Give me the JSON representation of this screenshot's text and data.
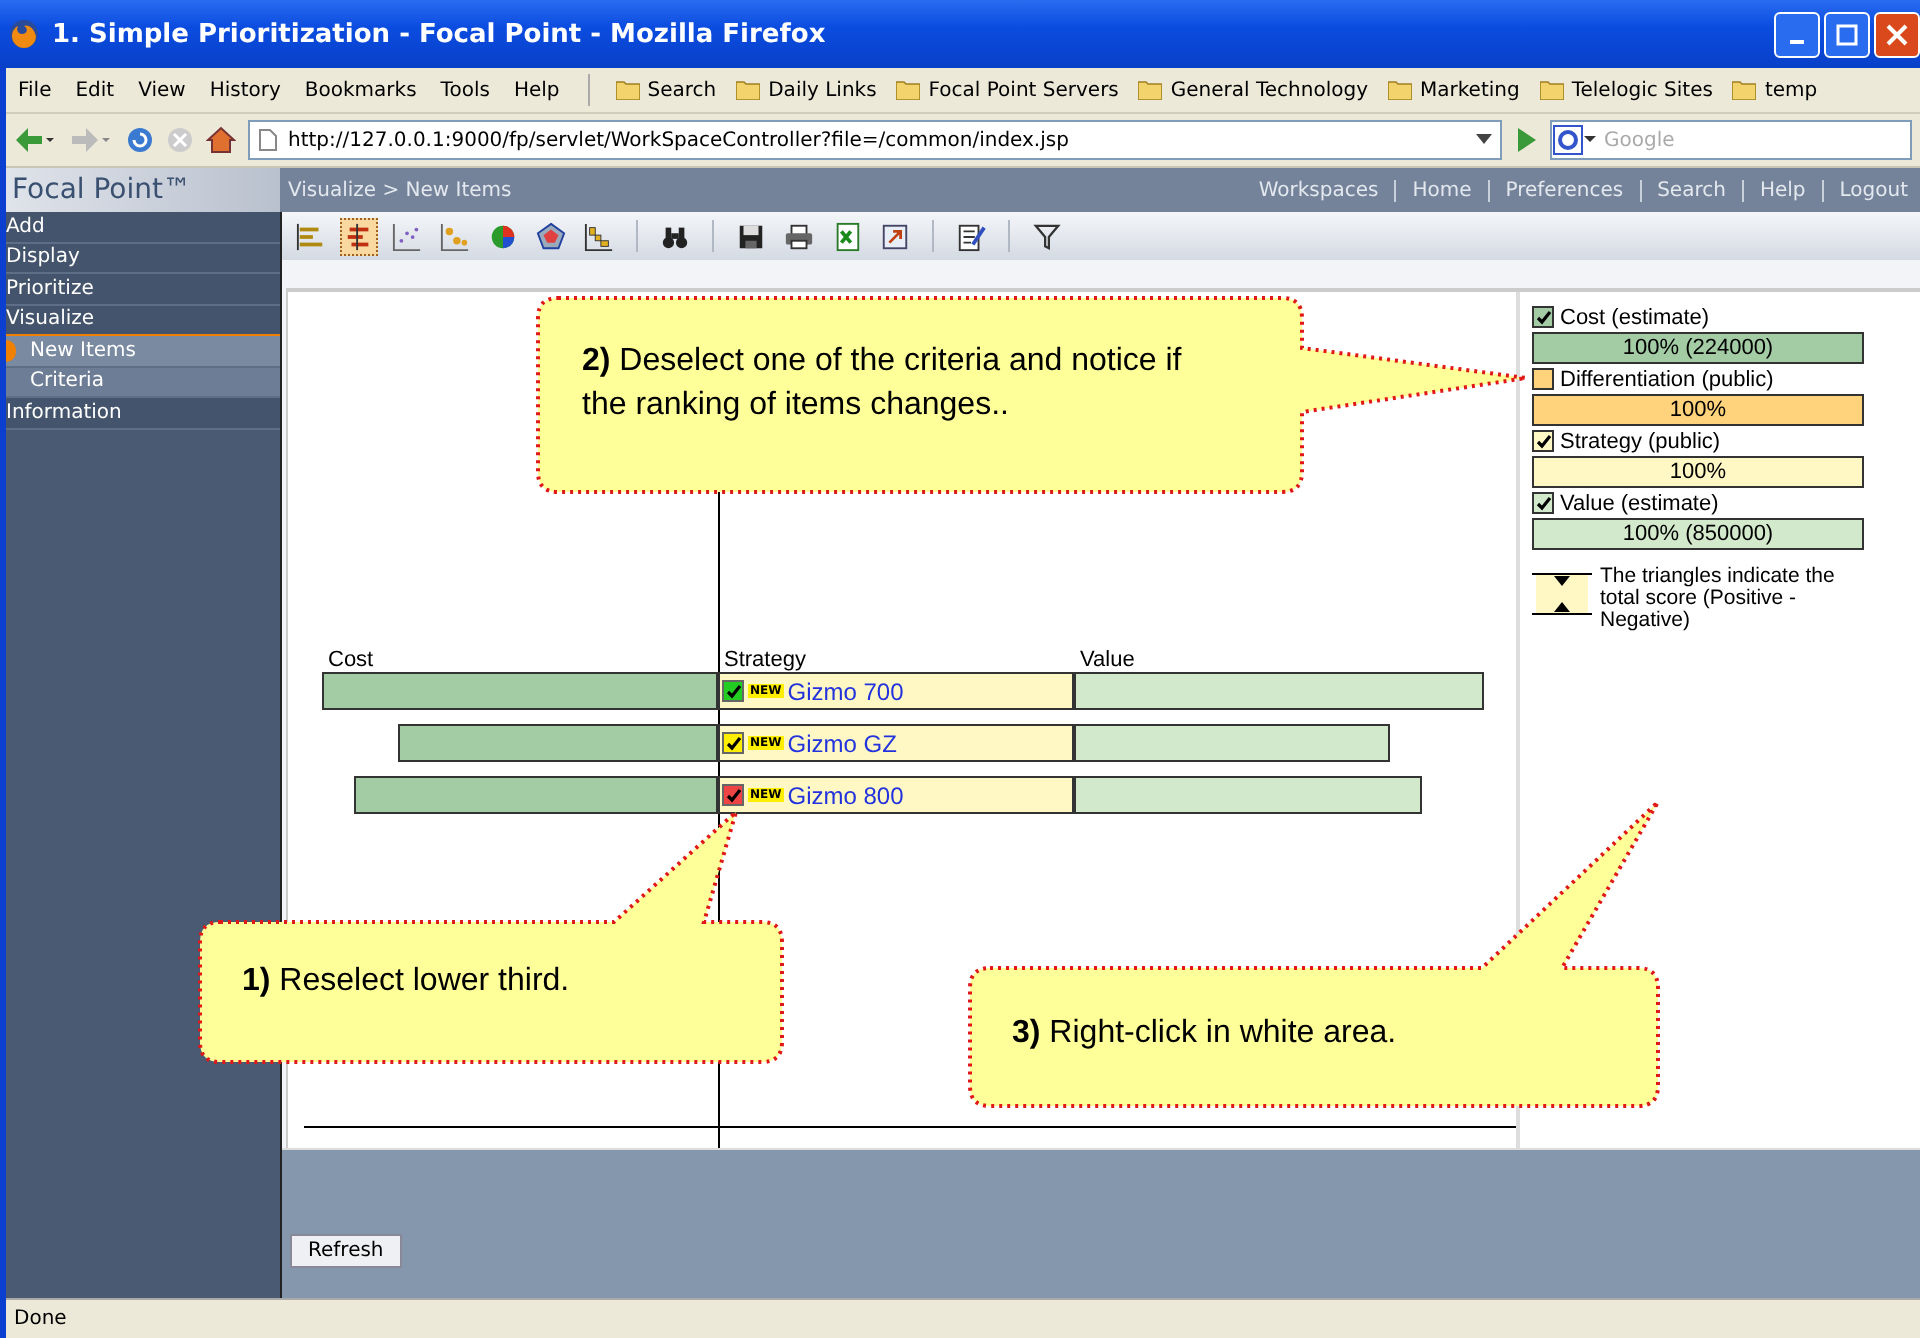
{
  "window": {
    "title": "1. Simple Prioritization - Focal Point - Mozilla Firefox"
  },
  "menu": [
    "File",
    "Edit",
    "View",
    "History",
    "Bookmarks",
    "Tools",
    "Help"
  ],
  "bookmarks": [
    "Search",
    "Daily Links",
    "Focal Point Servers",
    "General Technology",
    "Marketing",
    "Telelogic Sites",
    "temp"
  ],
  "address": {
    "url": "http://127.0.0.1:9000/fp/servlet/WorkSpaceController?file=/common/index.jsp"
  },
  "search": {
    "placeholder": "Google"
  },
  "app": {
    "logo": "Focal Point™",
    "breadcrumb": "Visualize > New Items",
    "links": [
      "Workspaces",
      "Home",
      "Preferences",
      "Search",
      "Help",
      "Logout"
    ]
  },
  "sidebar": {
    "items": [
      {
        "label": "Add",
        "selected": false
      },
      {
        "label": "Display",
        "selected": false
      },
      {
        "label": "Prioritize",
        "selected": false
      },
      {
        "label": "Visualize",
        "selected": true,
        "children": [
          {
            "label": "New Items",
            "selected": true
          },
          {
            "label": "Criteria",
            "selected": false
          }
        ]
      },
      {
        "label": "Information",
        "selected": false
      }
    ]
  },
  "toolbar": [
    [
      {
        "selected": false
      },
      {
        "selected": true
      },
      {
        "selected": false
      },
      {
        "selected": false
      },
      {
        "selected": false
      },
      {
        "selected": false
      },
      {
        "selected": false
      }
    ],
    [
      {
        "selected": false
      }
    ],
    [
      {
        "selected": false
      },
      {
        "selected": false
      },
      {
        "selected": false
      },
      {
        "selected": false
      }
    ],
    [
      {
        "selected": false
      }
    ],
    [
      {
        "selected": false
      }
    ]
  ],
  "chart": {
    "headers": [
      "Cost",
      "Strategy",
      "Value"
    ],
    "rows": [
      {
        "name": "Gizmo 700",
        "badge": "NEW",
        "color": "#22cc22"
      },
      {
        "name": "Gizmo GZ",
        "badge": "NEW",
        "color": "#ffee00"
      },
      {
        "name": "Gizmo 800",
        "badge": "NEW",
        "color": "#ee4444"
      }
    ]
  },
  "legend": {
    "criteria": [
      {
        "label": "Cost (estimate)",
        "checked": true,
        "color": "#a3cca5",
        "reading": "100% (224000)"
      },
      {
        "label": "Differentiation (public)",
        "checked": false,
        "color": "#ffd37c",
        "reading": "100%"
      },
      {
        "label": "Strategy (public)",
        "checked": true,
        "color": "#fff8c4",
        "reading": "100%"
      },
      {
        "label": "Value (estimate)",
        "checked": true,
        "color": "#d3e9cb",
        "reading": "100% (850000)"
      }
    ],
    "note": "The triangles indicate the total score (Positive - Negative)"
  },
  "callouts": [
    {
      "text": "**2)**  Deselect one of the criteria and notice if the ranking of items changes.."
    },
    {
      "text": "**1)**  Reselect lower third."
    },
    {
      "text": "**3)**  Right-click in white area."
    }
  ],
  "refresh": "Refresh",
  "status": "Done"
}
